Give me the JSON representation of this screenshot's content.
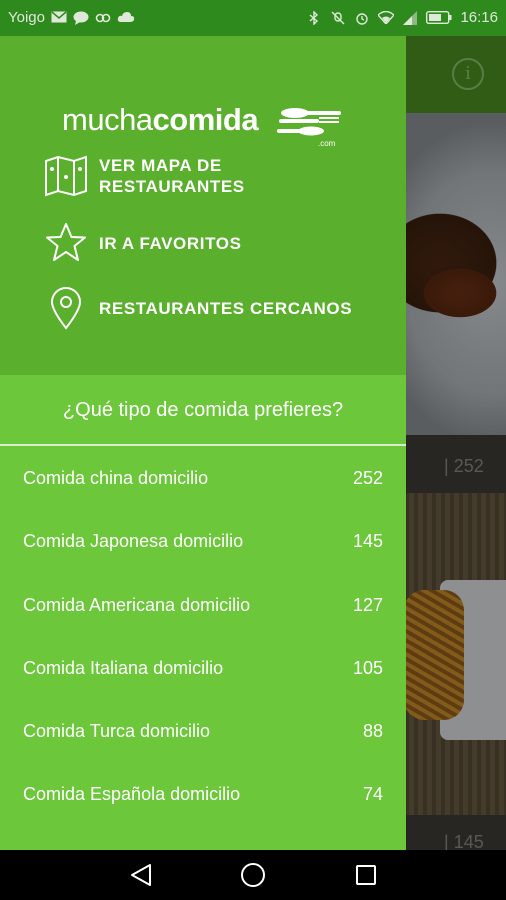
{
  "status_bar": {
    "carrier": "Yoigo",
    "time": "16:16",
    "icons_left": [
      "mail-icon",
      "chat-icon",
      "link-icon",
      "cloud-icon"
    ],
    "icons_right": [
      "bluetooth-icon",
      "mute-icon",
      "alarm-icon",
      "wifi-icon",
      "signal-icon",
      "battery-icon"
    ]
  },
  "background": {
    "card_counts": [
      "252",
      "145"
    ]
  },
  "drawer": {
    "logo": {
      "light": "mucha",
      "bold": "comida",
      "suffix": ".com"
    },
    "menu": [
      {
        "label_line1": "VER MAPA DE",
        "label_line2": "RESTAURANTES",
        "icon": "map-icon"
      },
      {
        "label_line1": "IR A FAVORITOS",
        "label_line2": "",
        "icon": "star-icon"
      },
      {
        "label_line1": "RESTAURANTES CERCANOS",
        "label_line2": "",
        "icon": "location-pin-icon"
      }
    ],
    "question": "¿Qué tipo de comida prefieres?",
    "categories": [
      {
        "name": "Comida china domicilio",
        "count": "252"
      },
      {
        "name": "Comida Japonesa domicilio",
        "count": "145"
      },
      {
        "name": "Comida Americana domicilio",
        "count": "127"
      },
      {
        "name": "Comida Italiana domicilio",
        "count": "105"
      },
      {
        "name": "Comida Turca domicilio",
        "count": "88"
      },
      {
        "name": "Comida Española domicilio",
        "count": "74"
      }
    ]
  },
  "colors": {
    "drawer_header": "#5aaf2d",
    "drawer_body": "#6cc73a",
    "status_bar": "#2f8a1e"
  }
}
